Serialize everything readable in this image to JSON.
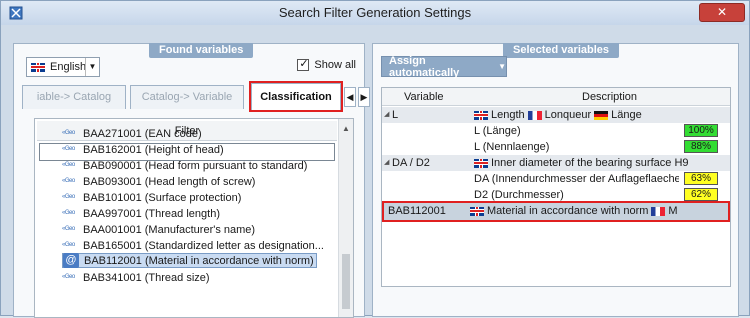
{
  "window": {
    "title": "Search Filter Generation Settings",
    "close_label": "✕"
  },
  "found_variables": {
    "header": "Found variables",
    "language": "English",
    "show_all_label": "Show all",
    "tabs": [
      "iable-> Catalog",
      "Catalog-> Variable",
      "Classification"
    ],
    "filter_header": "Filter",
    "filter_value": "",
    "items": [
      "BAA271001 (EAN code)",
      "BAB162001 (Height of head)",
      "BAB090001 (Head form pursuant to standard)",
      "BAB093001 (Head length of screw)",
      "BAB101001 (Surface protection)",
      "BAA997001 (Thread length)",
      "BAA001001 (Manufacturer's name)",
      "BAB165001 (Standardized letter as designation...",
      "BAB112001 (Material in accordance with norm)",
      "BAB341001 (Thread size)"
    ],
    "item_icon_text": "«Geo"
  },
  "selected_variables": {
    "header": "Selected variables",
    "assign_button": "Assign automatically",
    "columns": {
      "variable": "Variable",
      "description": "Description"
    },
    "rows": [
      {
        "variable": "L",
        "desc_en": "Length",
        "desc_fr": "Lonqueur",
        "desc_de": "Länge",
        "group": true
      },
      {
        "variable": "",
        "desc_plain": "L (Länge)",
        "percent": "100%",
        "color": "#33dd33"
      },
      {
        "variable": "",
        "desc_plain": "L (Nennlaenge)",
        "percent": "88%",
        "color": "#33dd33"
      },
      {
        "variable": "DA / D2",
        "desc_en": "Inner diameter of the bearing surface H9",
        "group": true
      },
      {
        "variable": "",
        "desc_plain": "DA (Innendurchmesser der Auflageflaeche H",
        "percent": "63%",
        "color": "#ffff22"
      },
      {
        "variable": "",
        "desc_plain": "D2 (Durchmesser)",
        "percent": "62%",
        "color": "#ffff22"
      },
      {
        "variable": "BAB112001",
        "desc_en": "Material in accordance with norm",
        "desc_tail": "M",
        "group": true
      }
    ]
  }
}
